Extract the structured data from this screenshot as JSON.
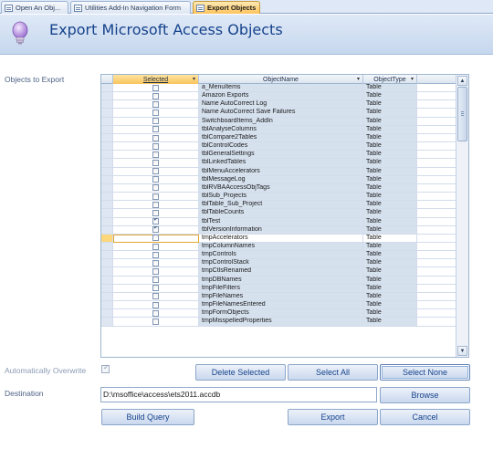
{
  "tabs": [
    {
      "label": "Open An Obj...",
      "active": false
    },
    {
      "label": "Utilities Add-In Navigation Form",
      "active": false
    },
    {
      "label": "Export Objects",
      "active": true
    }
  ],
  "header": {
    "title": "Export Microsoft Access Objects",
    "icon": "lightbulb-icon"
  },
  "objects_label": "Objects to Export",
  "grid": {
    "columns": {
      "selected": "Selected",
      "object_name": "ObjectName",
      "object_type": "ObjectType"
    },
    "rows": [
      {
        "name": "a_MenuItems",
        "type": "Table",
        "checked": false
      },
      {
        "name": "Amazon Exports",
        "type": "Table",
        "checked": false
      },
      {
        "name": "Name AutoCorrect Log",
        "type": "Table",
        "checked": false
      },
      {
        "name": "Name AutoCorrect Save Failures",
        "type": "Table",
        "checked": false
      },
      {
        "name": "SwitchboardItems_AddIn",
        "type": "Table",
        "checked": false
      },
      {
        "name": "tblAnalyseColumns",
        "type": "Table",
        "checked": false
      },
      {
        "name": "tblCompare2Tables",
        "type": "Table",
        "checked": false
      },
      {
        "name": "tblControlCodes",
        "type": "Table",
        "checked": false
      },
      {
        "name": "tblGeneralSettings",
        "type": "Table",
        "checked": false
      },
      {
        "name": "tblLinkedTables",
        "type": "Table",
        "checked": false
      },
      {
        "name": "tblMenuAccelerators",
        "type": "Table",
        "checked": false
      },
      {
        "name": "tblMessageLog",
        "type": "Table",
        "checked": false
      },
      {
        "name": "tblRVBAAccessObjTags",
        "type": "Table",
        "checked": false
      },
      {
        "name": "tblSub_Projects",
        "type": "Table",
        "checked": false
      },
      {
        "name": "tblTable_Sub_Project",
        "type": "Table",
        "checked": false
      },
      {
        "name": "tblTableCounts",
        "type": "Table",
        "checked": false
      },
      {
        "name": "tblTest",
        "type": "Table",
        "checked": true
      },
      {
        "name": "tblVersionInformation",
        "type": "Table",
        "checked": true
      },
      {
        "name": "tmpAccelerators",
        "type": "Table",
        "checked": false,
        "current": true
      },
      {
        "name": "tmpColumnNames",
        "type": "Table",
        "checked": false
      },
      {
        "name": "tmpControls",
        "type": "Table",
        "checked": false
      },
      {
        "name": "tmpControlStack",
        "type": "Table",
        "checked": false
      },
      {
        "name": "tmpCtlsRenamed",
        "type": "Table",
        "checked": false
      },
      {
        "name": "tmpDBNames",
        "type": "Table",
        "checked": false
      },
      {
        "name": "tmpFileFilters",
        "type": "Table",
        "checked": false
      },
      {
        "name": "tmpFileNames",
        "type": "Table",
        "checked": false
      },
      {
        "name": "tmpFileNamesEntered",
        "type": "Table",
        "checked": false
      },
      {
        "name": "tmpFormObjects",
        "type": "Table",
        "checked": false
      },
      {
        "name": "tmpMisspelledProperties",
        "type": "Table",
        "checked": false
      }
    ]
  },
  "auto_overwrite": {
    "label": "Automatically Overwrite",
    "checked": true
  },
  "destination": {
    "label": "Destination",
    "value": "D:\\msoffice\\access\\ets2011.accdb"
  },
  "buttons": {
    "delete_selected": "Delete Selected",
    "select_all": "Select All",
    "select_none": "Select None",
    "browse": "Browse",
    "build_query": "Build Query",
    "export": "Export",
    "cancel": "Cancel"
  }
}
